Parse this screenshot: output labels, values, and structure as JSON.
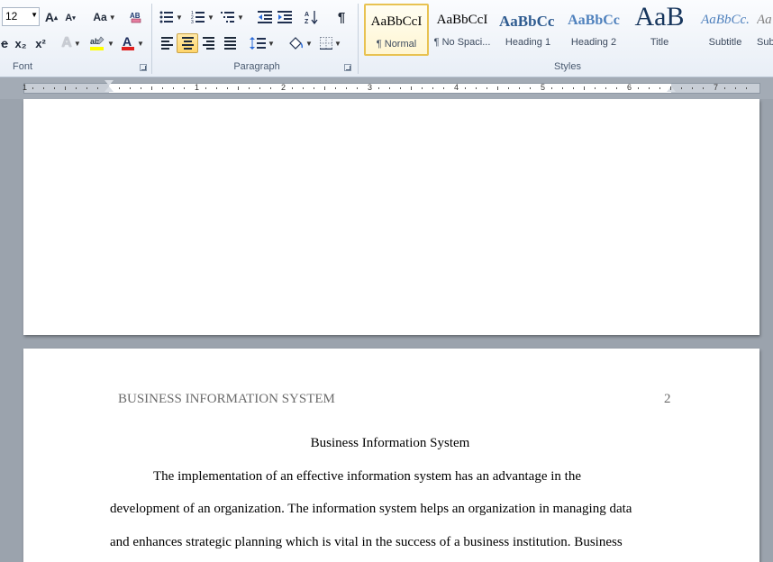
{
  "font_group": {
    "size_value": "12",
    "label": "Font",
    "grow_label": "A",
    "shrink_label": "A",
    "case_label": "Aa",
    "subscript_label": "x₂",
    "superscript_label": "x²",
    "color_label": "A",
    "strike_label": "e"
  },
  "paragraph_group": {
    "label": "Paragraph",
    "show_marks_label": "¶"
  },
  "styles_group": {
    "label": "Styles",
    "items": [
      {
        "sample": "AaBbCcI",
        "name": "¶ Normal"
      },
      {
        "sample": "AaBbCcI",
        "name": "¶ No Spaci..."
      },
      {
        "sample": "AaBbCc",
        "name": "Heading 1"
      },
      {
        "sample": "AaBbCc",
        "name": "Heading 2"
      },
      {
        "sample": "AaB",
        "name": "Title"
      },
      {
        "sample": "AaBbCc.",
        "name": "Subtitle"
      },
      {
        "sample": "Aa",
        "name": "Sub"
      }
    ]
  },
  "ruler": {
    "numbers": [
      "1",
      "1",
      "2",
      "3",
      "4",
      "5",
      "6",
      "7"
    ]
  },
  "document": {
    "running_head": "BUSINESS INFORMATION SYSTEM",
    "page_number": "2",
    "title": "Business Information System",
    "lines": [
      "The implementation of an effective information system has an advantage in the",
      "development of an organization. The information system helps an organization in managing  data",
      "and enhances strategic planning which is vital in the success of a business institution. Business"
    ]
  },
  "colors": {
    "highlight": "#ffff00",
    "font_color": "#e02020",
    "selected_style_border": "#e8c251",
    "workspace": "#9ba3ad"
  }
}
